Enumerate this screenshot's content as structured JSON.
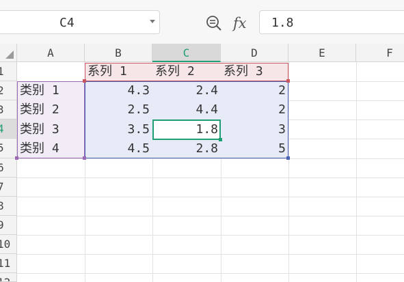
{
  "name_box": {
    "value": "C4"
  },
  "formula_bar": {
    "value": "1.8"
  },
  "icons": {
    "zoom": "zoom-formula-icon",
    "fx": "fx-icon",
    "fx_glyph": "fx"
  },
  "columns": [
    "A",
    "B",
    "C",
    "D",
    "E",
    "F"
  ],
  "rows": [
    "1",
    "2",
    "3",
    "4",
    "5",
    "6",
    "7",
    "8",
    "9",
    "10",
    "11",
    "12"
  ],
  "selected": {
    "column": "C",
    "row": "4"
  },
  "cells": {
    "B1": "系列 1",
    "C1": "系列 2",
    "D1": "系列 3",
    "A2": "类别 1",
    "B2": "4.3",
    "C2": "2.4",
    "D2": "2",
    "A3": "类别 2",
    "B3": "2.5",
    "C3": "4.4",
    "D3": "2",
    "A4": "类别 3",
    "B4": "3.5",
    "C4": "1.8",
    "D4": "3",
    "A5": "类别 4",
    "B5": "4.5",
    "C5": "2.8",
    "D5": "5"
  },
  "colors": {
    "series_header_border": "#c9575f",
    "category_border": "#9a6ab5",
    "values_border": "#4b63b2",
    "active_cell": "#1f9d74"
  }
}
